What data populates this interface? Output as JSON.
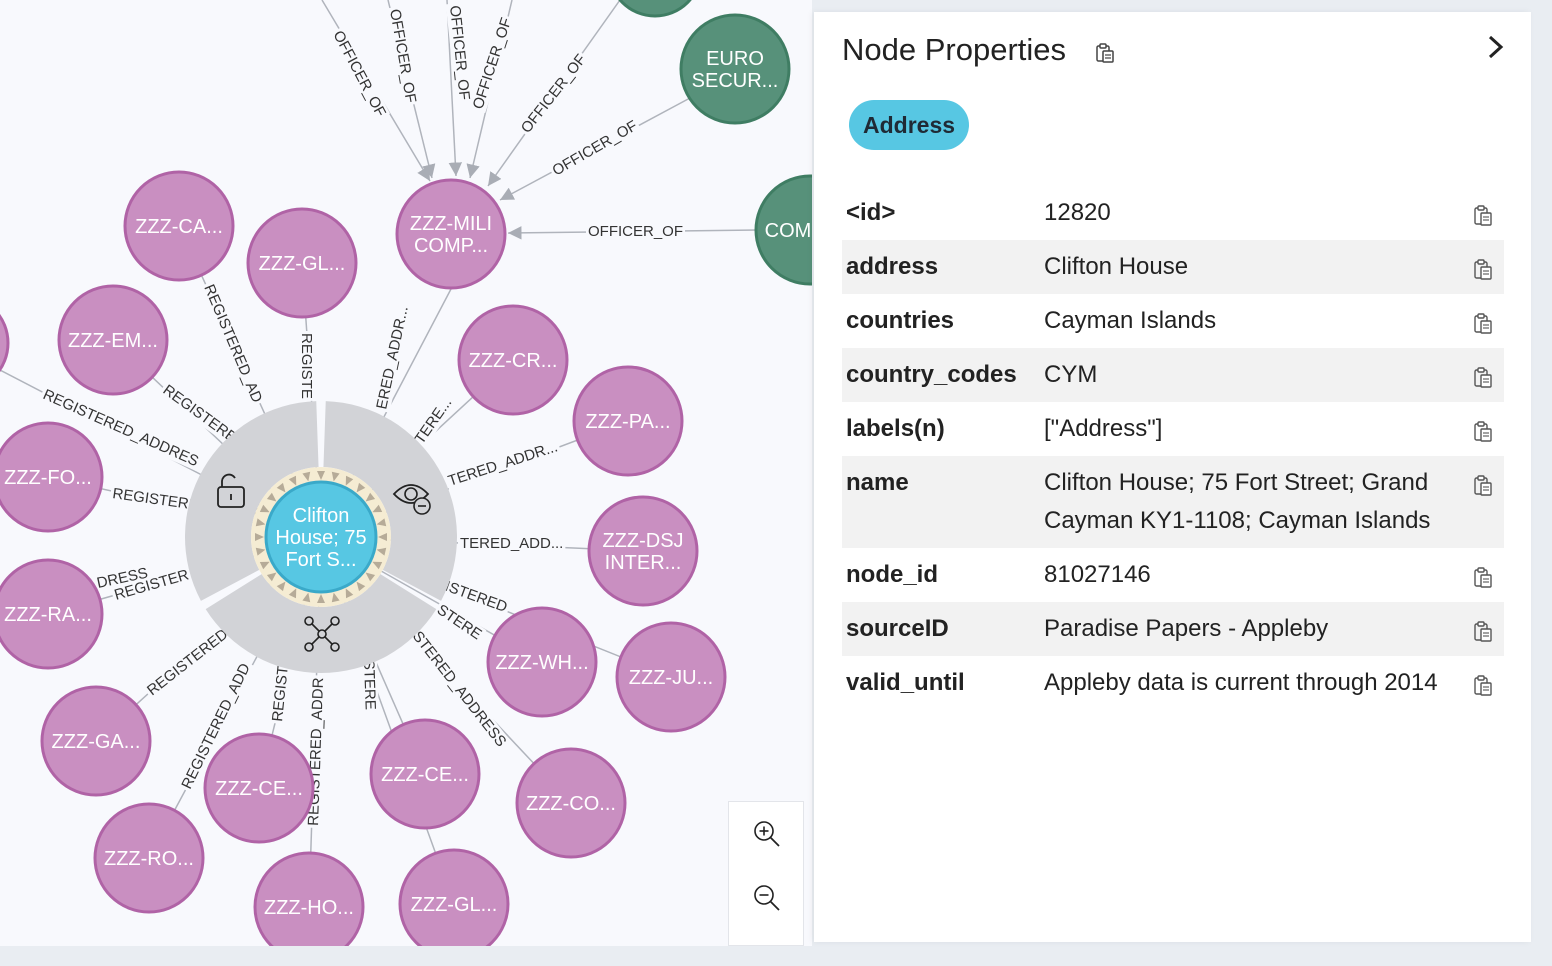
{
  "graph": {
    "center_node": {
      "lines": [
        "Clifton",
        "House; 75",
        "Fort S..."
      ]
    },
    "company_nodes": [
      {
        "lines": [
          "ZZZ-CA..."
        ]
      },
      {
        "lines": [
          "ZZZ-GL..."
        ]
      },
      {
        "lines": [
          "ZZZ-EM..."
        ]
      },
      {
        "lines": [
          "ZZZ-FO..."
        ]
      },
      {
        "lines": [
          "ZZZ-RA..."
        ]
      },
      {
        "lines": [
          "ZZZ-GA..."
        ]
      },
      {
        "lines": [
          "ZZZ-RO..."
        ]
      },
      {
        "lines": [
          "ZZZ-CE..."
        ]
      },
      {
        "lines": [
          "ZZZ-HO..."
        ]
      },
      {
        "lines": [
          "ZZZ-CE..."
        ]
      },
      {
        "lines": [
          "ZZZ-GL..."
        ]
      },
      {
        "lines": [
          "ZZZ-CO..."
        ]
      },
      {
        "lines": [
          "ZZZ-JU..."
        ]
      },
      {
        "lines": [
          "ZZZ-WH..."
        ]
      },
      {
        "lines": [
          "ZZZ-DSJ",
          "INTER..."
        ]
      },
      {
        "lines": [
          "ZZZ-PA..."
        ]
      },
      {
        "lines": [
          "ZZZ-CR..."
        ]
      },
      {
        "lines": [
          "ZZZ-MILI",
          "COMP..."
        ]
      }
    ],
    "officer_nodes": [
      {
        "lines": [
          "EURO",
          "SECUR..."
        ]
      },
      {
        "lines": [
          "COM"
        ]
      }
    ],
    "edge_labels": {
      "officer": "OFFICER_OF",
      "registered_full": "REGISTERED_ADDRESS",
      "registered_addr": "REGISTERED_ADDR...",
      "tered_addr": "TERED_ADDR...",
      "tered_add": "TERED_ADD...",
      "istered": "ISTERED",
      "registe": "REGISTE",
      "registered_ad": "REGISTERED_AD",
      "registered_add": "REGISTERED_ADD",
      "registere": "REGISTERE",
      "istere": "ISTERE",
      "stered_address": "STERED_ADDRESS",
      "ered_addr": "ERED_ADDR...",
      "registered_addres": "REGISTERED_ADDRES",
      "registered_addr2": "REGISTERED_ADDR",
      "registered": "REGISTERED",
      "regist": "REGIST",
      "register": "REGISTER",
      "tere": "TERE...",
      "stere": "STERE",
      "dress": "DRESS"
    },
    "ring_icons": [
      "unlock-icon",
      "hide-icon",
      "expand-icon"
    ],
    "colors": {
      "company": "#c98fc1",
      "company_border": "#b063a6",
      "officer": "#57917a",
      "officer_border": "#3f7d63",
      "address": "#57c7e3",
      "address_border": "#3aa9c9",
      "ring": "#d2d3d7"
    }
  },
  "zoom": {
    "zoom_in": "zoom-in-icon",
    "zoom_out": "zoom-out-icon"
  },
  "panel": {
    "title": "Node Properties",
    "badge": "Address",
    "properties": [
      {
        "key": "<id>",
        "value": "12820"
      },
      {
        "key": "address",
        "value": "Clifton House"
      },
      {
        "key": "countries",
        "value": "Cayman Islands"
      },
      {
        "key": "country_codes",
        "value": "CYM"
      },
      {
        "key": "labels(n)",
        "value": "[\"Address\"]"
      },
      {
        "key": "name",
        "value": "Clifton House; 75 Fort Street; Grand Cayman KY1-1108; Cayman Islands"
      },
      {
        "key": "node_id",
        "value": "81027146"
      },
      {
        "key": "sourceID",
        "value": "Paradise Papers - Appleby"
      },
      {
        "key": "valid_until",
        "value": "Appleby data is current through 2014"
      }
    ]
  }
}
